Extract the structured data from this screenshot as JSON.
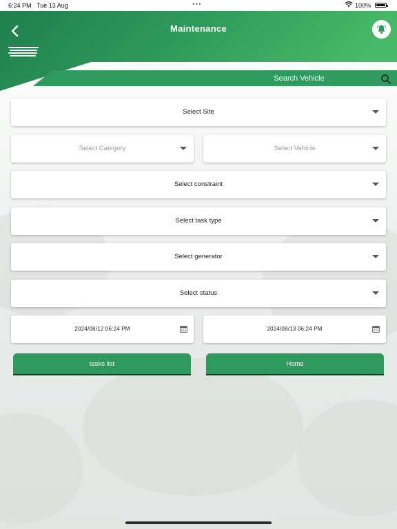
{
  "status_bar": {
    "time": "6:24 PM",
    "date": "Tue 13 Aug",
    "battery": "100%"
  },
  "header": {
    "title": "Maintenance",
    "search_label": "Search Vehicle"
  },
  "icons": {
    "back": "chevron-left-icon",
    "bell": "bell-icon",
    "menu": "menu-icon",
    "search": "search-icon",
    "calendar": "calendar-icon",
    "dropdown": "caret-down-icon"
  },
  "colors": {
    "primary_green": "#2e9a5d",
    "header_green_light": "#45b766"
  },
  "form": {
    "site": "Select Site",
    "category": "Select Category",
    "vehicle": "Select Vehicle",
    "constraint": "Select constraint",
    "task_type": "Select task type",
    "generator": "Select generator",
    "status": "Select status",
    "start_date": "2024/08/12 06:24 PM",
    "end_date": "2024/08/13 06:24 PM"
  },
  "buttons": {
    "tasks_list": "tasks list",
    "home": "Home"
  }
}
